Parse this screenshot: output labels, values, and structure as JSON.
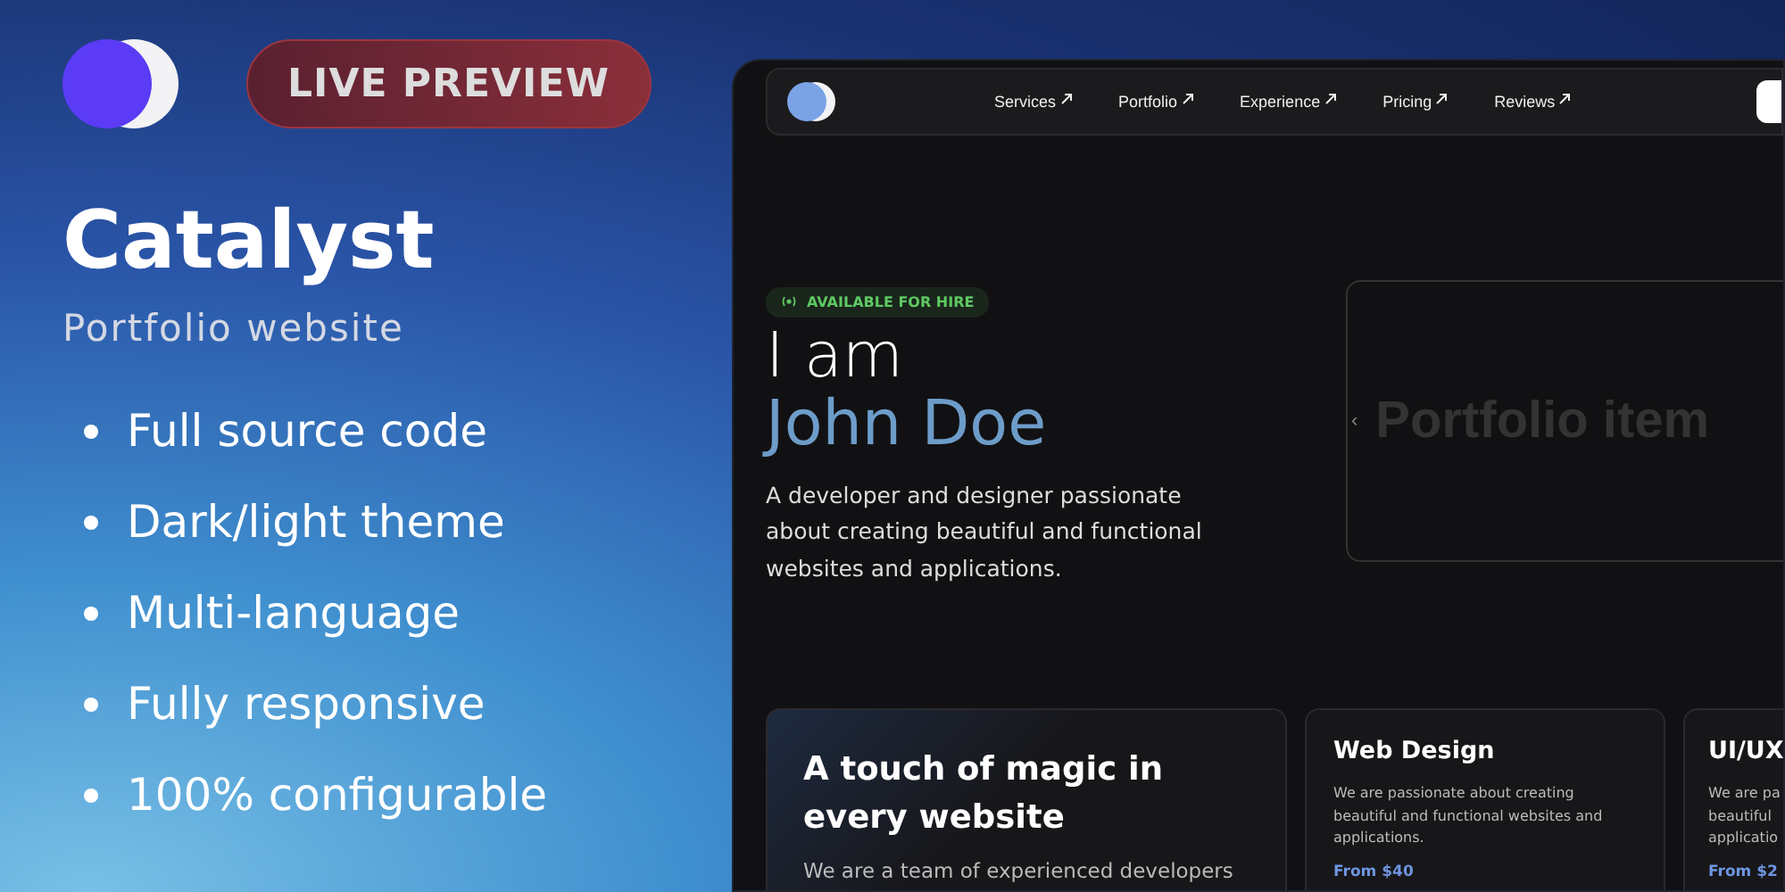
{
  "promo": {
    "live_preview": "LIVE PREVIEW",
    "title": "Catalyst",
    "subtitle": "Portfolio website",
    "features": [
      "Full source code",
      "Dark/light theme",
      "Multi-language",
      "Fully responsive",
      "100% configurable"
    ]
  },
  "site": {
    "nav": [
      {
        "label": "Services"
      },
      {
        "label": "Portfolio"
      },
      {
        "label": "Experience"
      },
      {
        "label": "Pricing"
      },
      {
        "label": "Reviews"
      }
    ],
    "hero": {
      "badge": "AVAILABLE FOR HIRE",
      "line1": "I am",
      "name": "John Doe",
      "text": "A developer and designer passionate about creating beautiful and functional websites and applications."
    },
    "portfolio": {
      "prev": "‹",
      "label": "Portfolio item"
    },
    "intro_card": {
      "title": "A touch of magic in every website",
      "text": "We are a team of experienced developers"
    },
    "services": [
      {
        "title": "Web Design",
        "lines": [
          "We are passionate about creating",
          "beautiful and functional websites and",
          "applications."
        ],
        "price": "From $40"
      },
      {
        "title": "UI/UX",
        "lines": [
          "We are pa",
          "beautiful",
          "applicatio"
        ],
        "price": "From $2"
      }
    ]
  }
}
